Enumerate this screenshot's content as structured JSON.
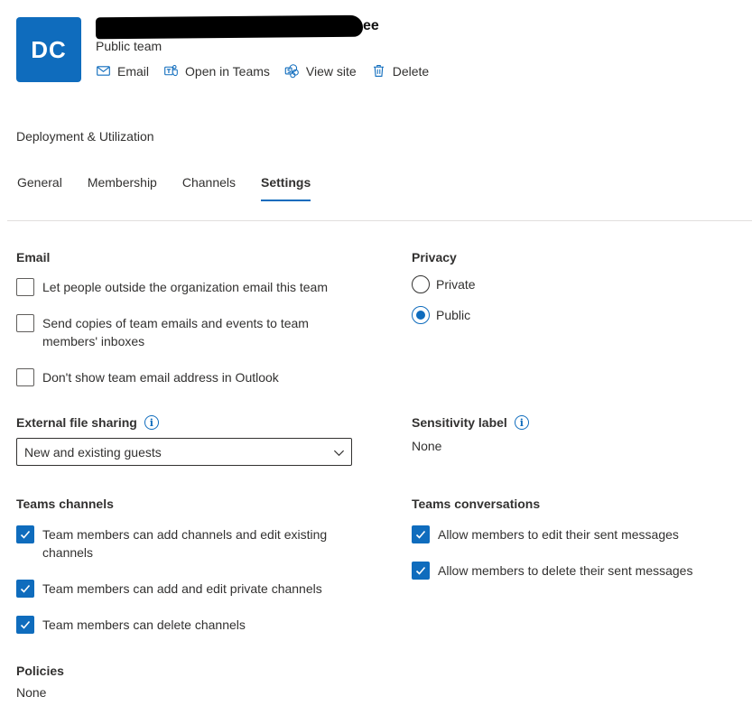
{
  "header": {
    "avatar_initials": "DC",
    "team_name_suffix": "ee",
    "team_type": "Public team",
    "actions": [
      {
        "label": "Email",
        "icon": "mail-icon"
      },
      {
        "label": "Open in Teams",
        "icon": "teams-icon"
      },
      {
        "label": "View site",
        "icon": "sharepoint-icon"
      },
      {
        "label": "Delete",
        "icon": "trash-icon"
      }
    ]
  },
  "breadcrumb": "Deployment & Utilization",
  "tabs": [
    {
      "label": "General",
      "active": false
    },
    {
      "label": "Membership",
      "active": false
    },
    {
      "label": "Channels",
      "active": false
    },
    {
      "label": "Settings",
      "active": true
    }
  ],
  "email": {
    "title": "Email",
    "options": [
      {
        "label": "Let people outside the organization email this team",
        "checked": false
      },
      {
        "label": "Send copies of team emails and events to team members' inboxes",
        "checked": false
      },
      {
        "label": "Don't show team email address in Outlook",
        "checked": false
      }
    ]
  },
  "privacy": {
    "title": "Privacy",
    "options": [
      {
        "label": "Private",
        "checked": false
      },
      {
        "label": "Public",
        "checked": true
      }
    ]
  },
  "external_sharing": {
    "title": "External file sharing",
    "value": "New and existing guests"
  },
  "sensitivity": {
    "title": "Sensitivity label",
    "value": "None"
  },
  "teams_channels": {
    "title": "Teams channels",
    "options": [
      {
        "label": "Team members can add channels and edit existing channels",
        "checked": true
      },
      {
        "label": "Team members can add and edit private channels",
        "checked": true
      },
      {
        "label": "Team members can delete channels",
        "checked": true
      }
    ]
  },
  "teams_conversations": {
    "title": "Teams conversations",
    "options": [
      {
        "label": "Allow members to edit their sent messages",
        "checked": true
      },
      {
        "label": "Allow members to delete their sent messages",
        "checked": true
      }
    ]
  },
  "policies": {
    "title": "Policies",
    "value": "None"
  },
  "colors": {
    "accent": "#0f6cbd",
    "text": "#323130",
    "divider": "#e1dfdd"
  }
}
